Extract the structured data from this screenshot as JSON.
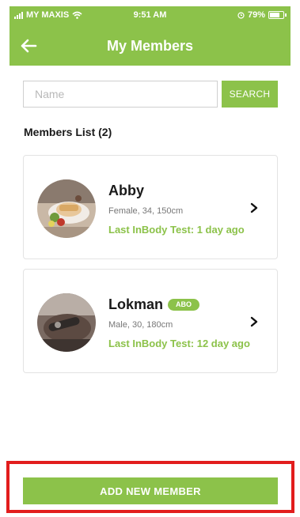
{
  "status_bar": {
    "carrier": "MY MAXIS",
    "time": "9:51 AM",
    "battery": "79%",
    "icons": [
      "signal-icon",
      "wifi-icon",
      "alarm-icon",
      "battery-icon"
    ]
  },
  "header": {
    "title": "My Members",
    "back_icon": "back-arrow-icon"
  },
  "search": {
    "placeholder": "Name",
    "value": "",
    "button_label": "SEARCH"
  },
  "members_list": {
    "title": "Members List (2)",
    "items": [
      {
        "name": "Abby",
        "info": "Female, 34, 150cm",
        "last_test": "Last InBody Test: 1 day ago",
        "badge": ""
      },
      {
        "name": "Lokman",
        "info": "Male, 30, 180cm",
        "last_test": "Last InBody Test: 12 day ago",
        "badge": "ABO"
      }
    ]
  },
  "footer": {
    "add_button_label": "ADD NEW MEMBER"
  },
  "colors": {
    "accent": "#8cc24a",
    "highlight": "#e21d1d"
  }
}
